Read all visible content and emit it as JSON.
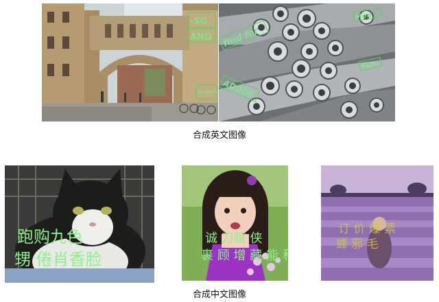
{
  "figure": {
    "caption_english": "合成英文图像",
    "caption_chinese": "合成中文图像"
  },
  "panels": [
    {
      "id": "bridge",
      "overlay_texts": [
        "-SG",
        "AND",
        "Ecotrav"
      ]
    },
    {
      "id": "pipes",
      "overlay_texts": [
        "Men",
        "find for",
        "ADOBE",
        "Fell"
      ]
    },
    {
      "id": "cat",
      "overlay_texts": [
        "跑购九色",
        "甥 倦肖香脸"
      ]
    },
    {
      "id": "girl",
      "overlay_texts": [
        "诚 刀赋 侠",
        "裹 顾 增 藏 能 和"
      ]
    },
    {
      "id": "lavender",
      "overlay_texts": [
        "订 价 爆 票",
        "蜂 邪 毛"
      ]
    }
  ]
}
